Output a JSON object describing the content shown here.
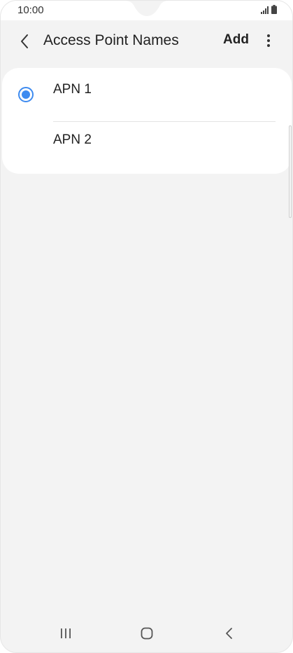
{
  "status_bar": {
    "time": "10:00",
    "icons": [
      "signal-icon",
      "battery-icon"
    ]
  },
  "app_bar": {
    "back_icon": "chevron-left-icon",
    "title": "Access Point Names",
    "add_label": "Add",
    "more_icon": "more-vertical-icon"
  },
  "apn_list": {
    "items": [
      {
        "label": "APN 1",
        "selected": true
      },
      {
        "label": "APN 2",
        "selected": false
      }
    ]
  },
  "nav_bar": {
    "icons": [
      "recent-apps-icon",
      "home-icon",
      "back-icon"
    ]
  },
  "colors": {
    "accent": "#3e8bf0",
    "background": "#f3f3f3",
    "card": "#ffffff",
    "text": "#222222"
  }
}
